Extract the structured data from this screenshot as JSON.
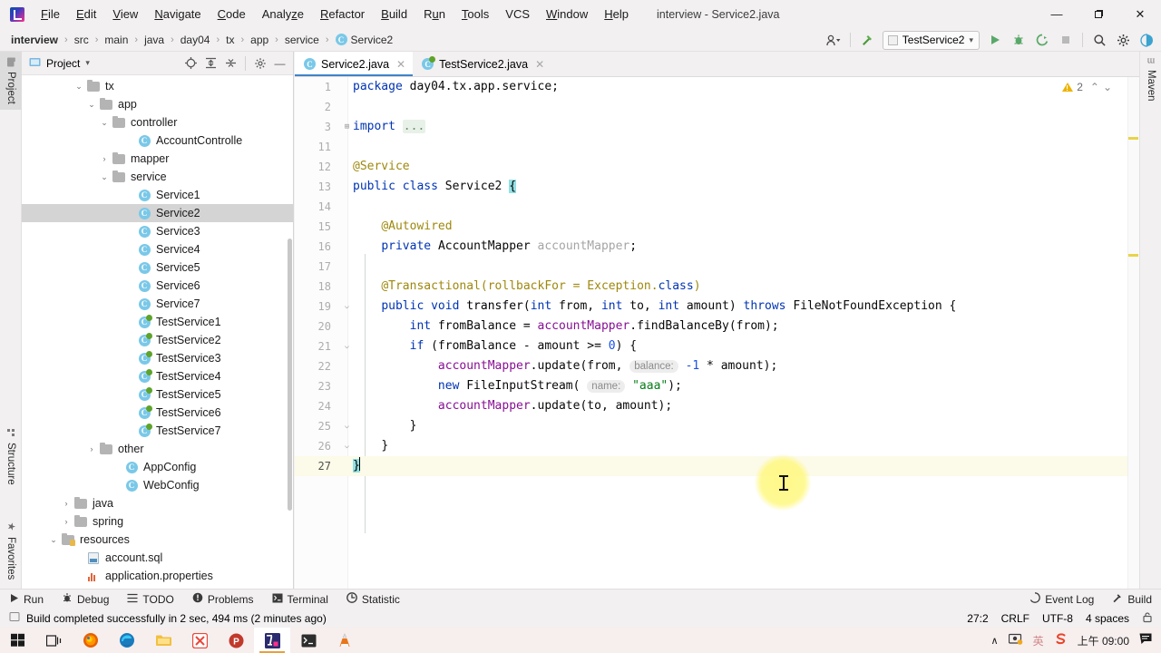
{
  "window": {
    "title": "interview - Service2.java",
    "minimize": "—",
    "maximize": "❐",
    "close": "✕"
  },
  "menu": [
    {
      "pre": "",
      "mn": "F",
      "post": "ile"
    },
    {
      "pre": "",
      "mn": "E",
      "post": "dit"
    },
    {
      "pre": "",
      "mn": "V",
      "post": "iew"
    },
    {
      "pre": "",
      "mn": "N",
      "post": "avigate"
    },
    {
      "pre": "",
      "mn": "C",
      "post": "ode"
    },
    {
      "pre": "Analy",
      "mn": "z",
      "post": "e"
    },
    {
      "pre": "",
      "mn": "R",
      "post": "efactor"
    },
    {
      "pre": "",
      "mn": "B",
      "post": "uild"
    },
    {
      "pre": "R",
      "mn": "u",
      "post": "n"
    },
    {
      "pre": "",
      "mn": "T",
      "post": "ools"
    },
    {
      "pre": "VCS",
      "mn": "",
      "post": ""
    },
    {
      "pre": "",
      "mn": "W",
      "post": "indow"
    },
    {
      "pre": "",
      "mn": "H",
      "post": "elp"
    }
  ],
  "breadcrumb": {
    "items": [
      "interview",
      "src",
      "main",
      "java",
      "day04",
      "tx",
      "app",
      "service"
    ],
    "class": "Service2",
    "separator": "›"
  },
  "toolbar": {
    "run_config": "TestService2",
    "dropdown_arrow": "▾",
    "user_icon": "user-icon",
    "hammer_icon": "build-hammer-icon",
    "run_icon": "▶",
    "debug_icon": "debug-icon",
    "coverage_icon": "coverage-icon",
    "stop_icon": "■",
    "search_icon": "⌕",
    "settings_icon": "⚙",
    "ai_icon": "assistant-icon"
  },
  "left_strip": {
    "project": "Project",
    "structure": "Structure",
    "favorites": "Favorites"
  },
  "right_strip": {
    "maven": "Maven"
  },
  "project_panel": {
    "title": "Project",
    "dropdown": "▾",
    "icons": {
      "locate": "locate-icon",
      "expand_all": "expand-all-icon",
      "collapse_all": "collapse-all-icon",
      "settings": "⚙",
      "hide": "—"
    },
    "tree": [
      {
        "label": "tx",
        "indent": 5,
        "type": "folder",
        "twist": "v"
      },
      {
        "label": "app",
        "indent": 6,
        "type": "folder",
        "twist": "v"
      },
      {
        "label": "controller",
        "indent": 7,
        "type": "folder",
        "twist": "v"
      },
      {
        "label": "AccountControlle",
        "indent": 9,
        "type": "class",
        "twist": ""
      },
      {
        "label": "mapper",
        "indent": 7,
        "type": "folder",
        "twist": ">"
      },
      {
        "label": "service",
        "indent": 7,
        "type": "folder",
        "twist": "v"
      },
      {
        "label": "Service1",
        "indent": 9,
        "type": "class",
        "twist": ""
      },
      {
        "label": "Service2",
        "indent": 9,
        "type": "class",
        "twist": "",
        "selected": true
      },
      {
        "label": "Service3",
        "indent": 9,
        "type": "class",
        "twist": ""
      },
      {
        "label": "Service4",
        "indent": 9,
        "type": "class",
        "twist": ""
      },
      {
        "label": "Service5",
        "indent": 9,
        "type": "class",
        "twist": ""
      },
      {
        "label": "Service6",
        "indent": 9,
        "type": "class",
        "twist": ""
      },
      {
        "label": "Service7",
        "indent": 9,
        "type": "class",
        "twist": ""
      },
      {
        "label": "TestService1",
        "indent": 9,
        "type": "test",
        "twist": ""
      },
      {
        "label": "TestService2",
        "indent": 9,
        "type": "test",
        "twist": ""
      },
      {
        "label": "TestService3",
        "indent": 9,
        "type": "test",
        "twist": ""
      },
      {
        "label": "TestService4",
        "indent": 9,
        "type": "test",
        "twist": ""
      },
      {
        "label": "TestService5",
        "indent": 9,
        "type": "test",
        "twist": ""
      },
      {
        "label": "TestService6",
        "indent": 9,
        "type": "test",
        "twist": ""
      },
      {
        "label": "TestService7",
        "indent": 9,
        "type": "test",
        "twist": ""
      },
      {
        "label": "other",
        "indent": 6,
        "type": "folder",
        "twist": ">"
      },
      {
        "label": "AppConfig",
        "indent": 8,
        "type": "class",
        "twist": ""
      },
      {
        "label": "WebConfig",
        "indent": 8,
        "type": "class",
        "twist": ""
      },
      {
        "label": "java",
        "indent": 4,
        "type": "folder",
        "twist": ">"
      },
      {
        "label": "spring",
        "indent": 4,
        "type": "folder",
        "twist": ">"
      },
      {
        "label": "resources",
        "indent": 3,
        "type": "resources",
        "twist": "v"
      },
      {
        "label": "account.sql",
        "indent": 5,
        "type": "sql",
        "twist": ""
      },
      {
        "label": "application.properties",
        "indent": 5,
        "type": "properties",
        "twist": ""
      }
    ]
  },
  "editor": {
    "tabs": [
      {
        "label": "Service2.java",
        "type": "class",
        "active": true,
        "close": "✕"
      },
      {
        "label": "TestService2.java",
        "type": "test",
        "active": false,
        "close": "✕"
      }
    ],
    "inspection": {
      "warning_count": "2",
      "up": "⌃",
      "down": "⌄"
    },
    "lines": [
      {
        "num": "1",
        "fold": "",
        "caret": false
      },
      {
        "num": "2",
        "fold": "",
        "caret": false
      },
      {
        "num": "3",
        "fold": "+",
        "caret": false
      },
      {
        "num": "11",
        "fold": "",
        "caret": false
      },
      {
        "num": "12",
        "fold": "",
        "caret": false
      },
      {
        "num": "13",
        "fold": "",
        "caret": false
      },
      {
        "num": "14",
        "fold": "",
        "caret": false
      },
      {
        "num": "15",
        "fold": "",
        "caret": false
      },
      {
        "num": "16",
        "fold": "",
        "caret": false
      },
      {
        "num": "17",
        "fold": "",
        "caret": false
      },
      {
        "num": "18",
        "fold": "",
        "caret": false
      },
      {
        "num": "19",
        "fold": "v",
        "caret": false
      },
      {
        "num": "20",
        "fold": "",
        "caret": false
      },
      {
        "num": "21",
        "fold": "v",
        "caret": false
      },
      {
        "num": "22",
        "fold": "",
        "caret": false
      },
      {
        "num": "23",
        "fold": "",
        "caret": false
      },
      {
        "num": "24",
        "fold": "",
        "caret": false
      },
      {
        "num": "25",
        "fold": "^",
        "caret": false
      },
      {
        "num": "26",
        "fold": "^",
        "caret": false
      },
      {
        "num": "27",
        "fold": "",
        "caret": true
      }
    ],
    "code": {
      "l1": "package day04.tx.app.service;",
      "l3": "import ...",
      "l12": "@Service",
      "l13": "public class Service2 {",
      "l15": "@Autowired",
      "l16": "private AccountMapper accountMapper;",
      "l18": "@Transactional(rollbackFor = Exception.class)",
      "l19": "public void transfer(int from, int to, int amount) throws FileNotFoundException {",
      "l20": "int fromBalance = accountMapper.findBalanceBy(from);",
      "l21": "if (fromBalance - amount >= 0) {",
      "l22": "accountMapper.update(from, balance: -1 * amount);",
      "l23": "new FileInputStream( name: \"aaa\");",
      "l24": "accountMapper.update(to, amount);",
      "l25": "}",
      "l26": "}",
      "l27": "}"
    },
    "hints": {
      "balance": "balance:",
      "name": "name:"
    }
  },
  "bottom_bar": {
    "items": [
      {
        "label": "Run",
        "icon": "▶"
      },
      {
        "label": "Debug",
        "icon": "debug-icon"
      },
      {
        "label": "TODO",
        "icon": "todo-icon"
      },
      {
        "label": "Problems",
        "icon": "problems-icon"
      },
      {
        "label": "Terminal",
        "icon": "terminal-icon"
      },
      {
        "label": "Statistic",
        "icon": "statistic-icon"
      }
    ],
    "right": [
      {
        "label": "Event Log",
        "icon": "event-log-icon"
      },
      {
        "label": "Build",
        "icon": "build-icon"
      }
    ]
  },
  "status_bar": {
    "message": "Build completed successfully in 2 sec, 494 ms (2 minutes ago)",
    "position": "27:2",
    "line_separator": "CRLF",
    "encoding": "UTF-8",
    "indent": "4 spaces",
    "lock_icon": "lock-icon"
  },
  "taskbar": {
    "items": [
      {
        "name": "start-button"
      },
      {
        "name": "task-view-button"
      },
      {
        "name": "firefox-icon"
      },
      {
        "name": "edge-icon"
      },
      {
        "name": "file-explorer-icon"
      },
      {
        "name": "xmind-icon"
      },
      {
        "name": "powerpoint-icon"
      },
      {
        "name": "intellij-idea-icon",
        "active": true
      },
      {
        "name": "terminal-icon"
      },
      {
        "name": "vlc-icon"
      }
    ],
    "tray": {
      "chevron": "∧",
      "network_icon": "network-icon",
      "ime": "英",
      "sogou_icon": "sogou-icon",
      "clock": "上午 09:00",
      "notification_icon": "notification-icon"
    }
  },
  "colors": {
    "accent": "#4083c9",
    "keyword": "#0033b3",
    "string": "#067d17",
    "annotation": "#9e880d",
    "field": "#871094",
    "number": "#1750eb",
    "warning": "#edb200",
    "caret_line": "#fcfae8"
  }
}
